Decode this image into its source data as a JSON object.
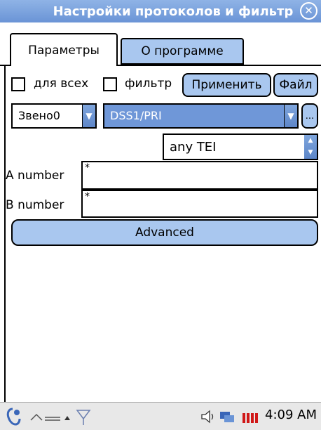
{
  "window": {
    "title": "Настройки протоколов и фильтр"
  },
  "tabs": [
    {
      "label": "Параметры",
      "active": true
    },
    {
      "label": "О программе",
      "active": false
    }
  ],
  "row1": {
    "all_checkbox_label": "для всех",
    "filter_checkbox_label": "фильтр",
    "apply_button": "Применить",
    "file_button": "Файл"
  },
  "row2": {
    "link_select": "Звено0",
    "protocol_select": "DSS1/PRI",
    "more_button": "..."
  },
  "tei": {
    "value": "any TEI"
  },
  "a_number": {
    "label": "A number",
    "value": "*"
  },
  "b_number": {
    "label": "B number",
    "value": "*"
  },
  "advanced_button": "Advanced",
  "taskbar": {
    "clock": "4:09 AM"
  },
  "colors": {
    "accent": "#a9c7ef",
    "title_bar": "#7aa3dd",
    "selection": "#6f97d8"
  }
}
